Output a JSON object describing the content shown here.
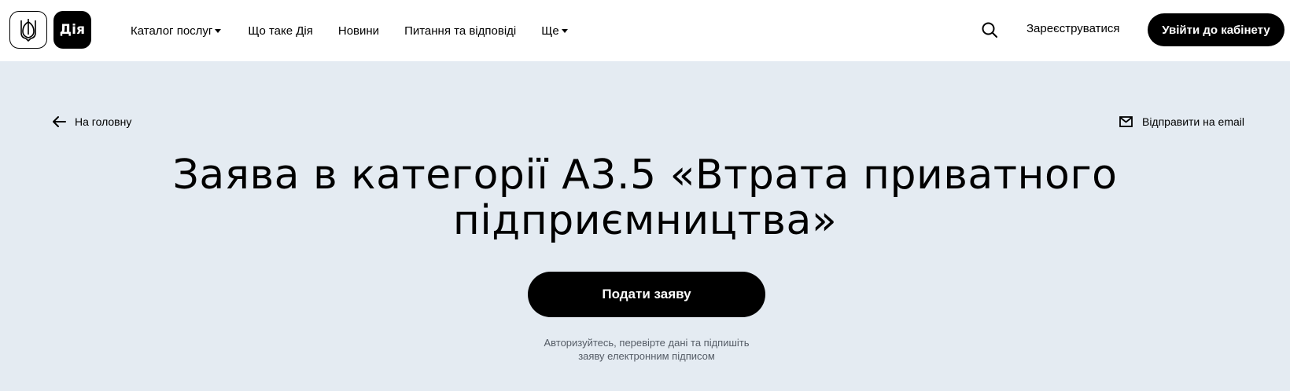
{
  "header": {
    "logo_trident_icon": "trident-icon",
    "logo_text": "Дія",
    "nav": [
      {
        "label": "Каталог послуг",
        "has_caret": true
      },
      {
        "label": "Що таке Дія",
        "has_caret": false
      },
      {
        "label": "Новини",
        "has_caret": false
      },
      {
        "label": "Питання та відповіді",
        "has_caret": false
      },
      {
        "label": "Ще",
        "has_caret": true
      }
    ],
    "search_icon": "search-icon",
    "register_label": "Зареєструватися",
    "login_label": "Увійти до кабінету"
  },
  "page": {
    "back_label": "На головну",
    "email_label": "Відправити на email",
    "title_line1": "Заява в категорії А3.5 «Втрата приватного",
    "title_line2": "підприємництва»",
    "submit_label": "Подати заяву",
    "hint_line1": "Авторизуйтесь, перевірте дані та підпишіть",
    "hint_line2": "заяву електронним підписом"
  },
  "colors": {
    "background": "#e4ebf2",
    "header_bg": "#ffffff",
    "button_bg": "#000000",
    "button_text": "#ffffff",
    "hint_text": "#555c66"
  }
}
